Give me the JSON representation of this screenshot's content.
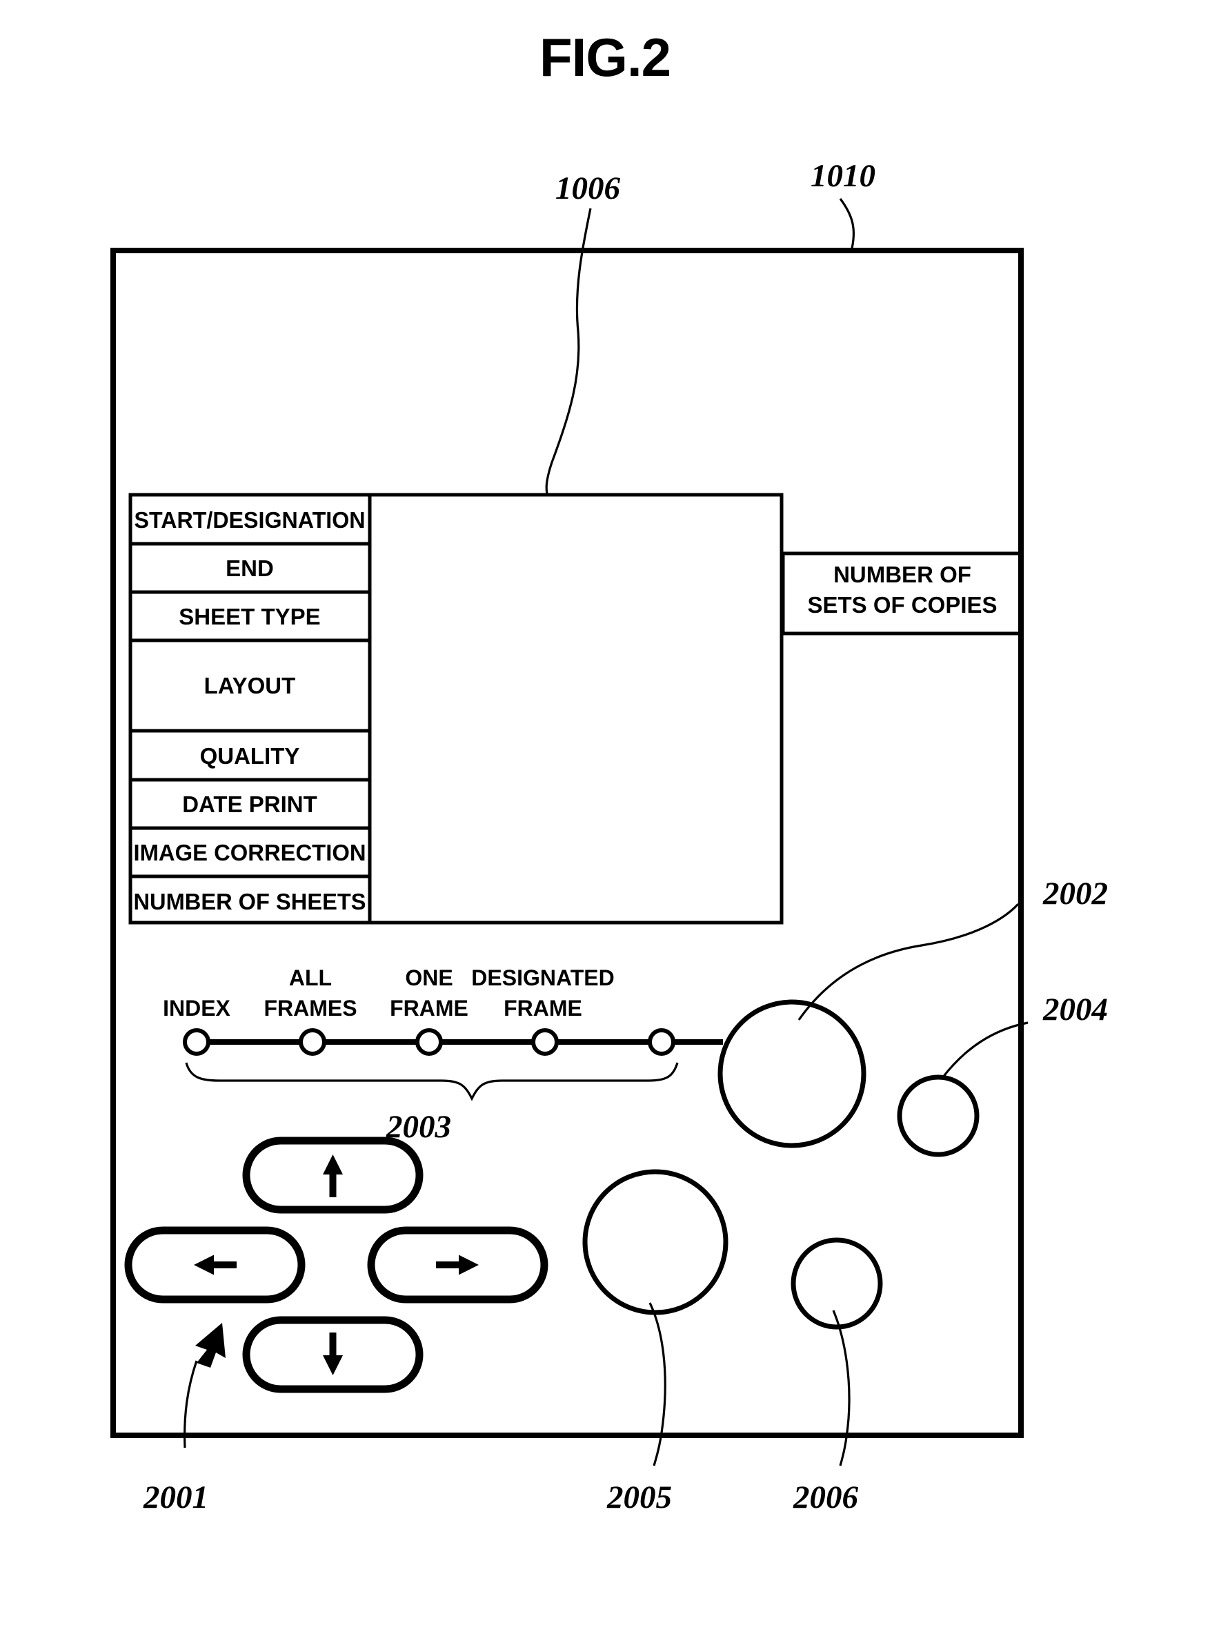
{
  "figure": {
    "title": "FIG.2",
    "reference_numbers": {
      "display_panel": "1006",
      "operation_panel": "1010",
      "dial_large_upper": "2002",
      "mode_selector": "2003",
      "button_small_upper": "2004",
      "cursor_keys": "2001",
      "dial_large_lower": "2005",
      "button_small_lower": "2006"
    }
  },
  "menu": {
    "items": [
      {
        "label": "START/DESIGNATION"
      },
      {
        "label": "END"
      },
      {
        "label": "SHEET TYPE"
      },
      {
        "label": "LAYOUT"
      },
      {
        "label": "QUALITY"
      },
      {
        "label": "DATE PRINT"
      },
      {
        "label": "IMAGE CORRECTION"
      },
      {
        "label": "NUMBER OF SHEETS"
      }
    ]
  },
  "copies_box": {
    "line1": "NUMBER OF",
    "line2": "SETS OF COPIES"
  },
  "mode_selector": {
    "options": [
      {
        "label_line1": "INDEX",
        "label_line2": ""
      },
      {
        "label_line1": "ALL",
        "label_line2": "FRAMES"
      },
      {
        "label_line1": "ONE",
        "label_line2": "FRAME"
      },
      {
        "label_line1": "DESIGNATED",
        "label_line2": "FRAME"
      },
      {
        "label_line1": "",
        "label_line2": ""
      }
    ]
  },
  "cursor_keys": {
    "up": "↑",
    "down": "↓",
    "left": "←",
    "right": "→"
  },
  "colors": {
    "ink": "#000000",
    "paper": "#ffffff"
  }
}
